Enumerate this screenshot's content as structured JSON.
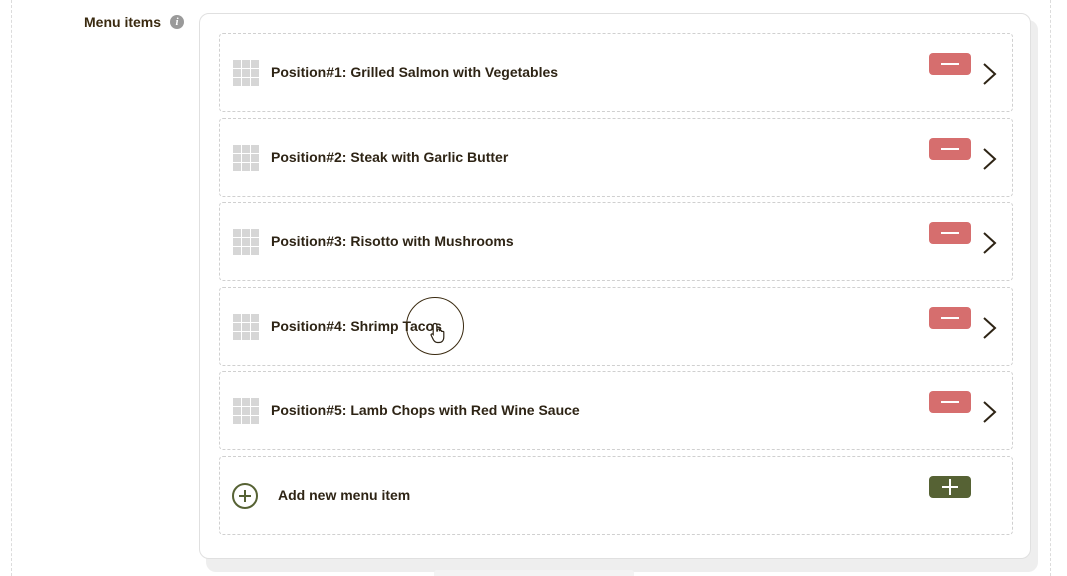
{
  "section": {
    "title": "Menu items",
    "info_icon": "info-icon"
  },
  "menu_items": [
    {
      "label": "Position#1: Grilled Salmon with Vegetables"
    },
    {
      "label": "Position#2: Steak with Garlic Butter"
    },
    {
      "label": "Position#3: Risotto with Mushrooms"
    },
    {
      "label": "Position#4: Shrimp Tacos"
    },
    {
      "label": "Position#5: Lamb Chops with Red Wine Sauce"
    }
  ],
  "add_item": {
    "label": "Add new menu item"
  },
  "icons": {
    "drag": "drag-handle-icon",
    "remove": "minus-icon",
    "expand": "chevron-right-icon",
    "add": "plus-circle-icon",
    "cursor": "hand-pointer-icon"
  },
  "colors": {
    "remove_button": "#d66e6e",
    "add_button": "#566234",
    "text": "#2e2415"
  }
}
